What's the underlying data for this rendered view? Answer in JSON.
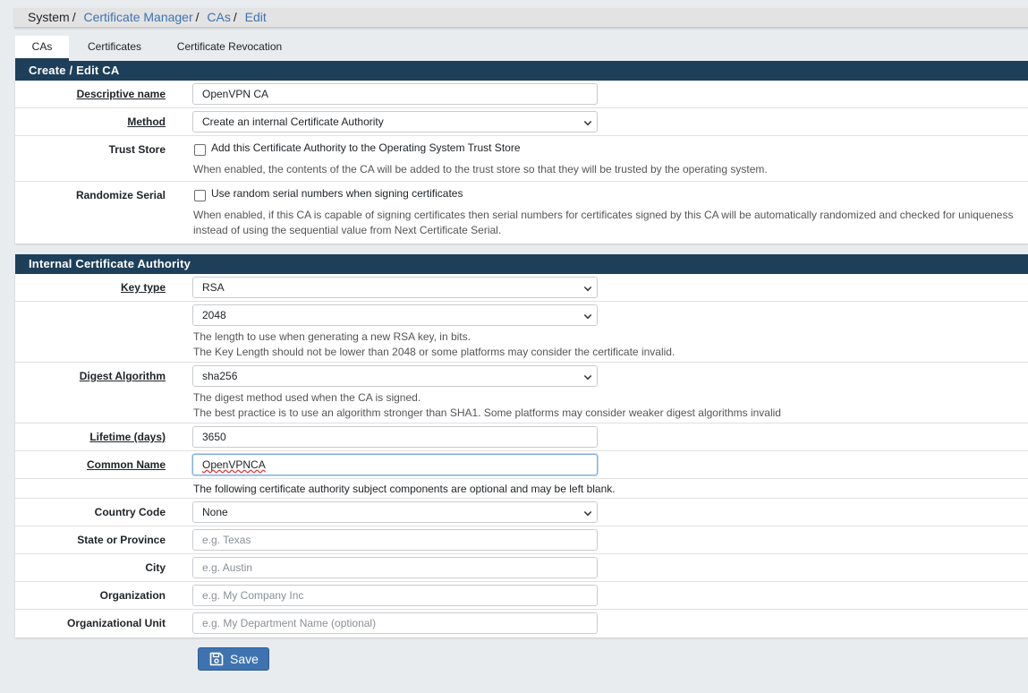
{
  "breadcrumb": {
    "root": "System",
    "items": [
      "Certificate Manager",
      "CAs",
      "Edit"
    ],
    "separator": "/"
  },
  "tabs": [
    {
      "label": "CAs",
      "active": true
    },
    {
      "label": "Certificates",
      "active": false
    },
    {
      "label": "Certificate Revocation",
      "active": false
    }
  ],
  "section1": {
    "title": "Create / Edit CA",
    "descriptive_name": {
      "label": "Descriptive name",
      "value": "OpenVPN CA"
    },
    "method": {
      "label": "Method",
      "value": "Create an internal Certificate Authority"
    },
    "trust_store": {
      "label": "Trust Store",
      "checkbox_label": "Add this Certificate Authority to the Operating System Trust Store",
      "checked": false,
      "help": "When enabled, the contents of the CA will be added to the trust store so that they will be trusted by the operating system."
    },
    "randomize_serial": {
      "label": "Randomize Serial",
      "checkbox_label": "Use random serial numbers when signing certificates",
      "checked": false,
      "help_line1": "When enabled, if this CA is capable of signing certificates then serial numbers for certificates signed by this CA will be automatically randomized and checked for uniqueness",
      "help_line2": "instead of using the sequential value from Next Certificate Serial."
    }
  },
  "section2": {
    "title": "Internal Certificate Authority",
    "key_type": {
      "label": "Key type",
      "value": "RSA"
    },
    "key_length": {
      "value": "2048",
      "help_line1": "The length to use when generating a new RSA key, in bits.",
      "help_line2": "The Key Length should not be lower than 2048 or some platforms may consider the certificate invalid."
    },
    "digest": {
      "label": "Digest Algorithm",
      "value": "sha256",
      "help_line1": "The digest method used when the CA is signed.",
      "help_line2": "The best practice is to use an algorithm stronger than SHA1. Some platforms may consider weaker digest algorithms invalid"
    },
    "lifetime": {
      "label": "Lifetime (days)",
      "value": "3650"
    },
    "common_name": {
      "label": "Common Name",
      "value": "OpenVPNCA"
    },
    "optional_note": "The following certificate authority subject components are optional and may be left blank.",
    "country": {
      "label": "Country Code",
      "value": "None"
    },
    "state": {
      "label": "State or Province",
      "placeholder": "e.g. Texas"
    },
    "city": {
      "label": "City",
      "placeholder": "e.g. Austin"
    },
    "organization": {
      "label": "Organization",
      "placeholder": "e.g. My Company Inc"
    },
    "org_unit": {
      "label": "Organizational Unit",
      "placeholder": "e.g. My Department Name (optional)"
    }
  },
  "save_button": {
    "label": "Save",
    "icon": "save-icon"
  },
  "colors": {
    "header_bg": "#1e3f5a",
    "link": "#3e73b0",
    "button": "#3e73b0",
    "page_bg": "#e9ecef"
  }
}
